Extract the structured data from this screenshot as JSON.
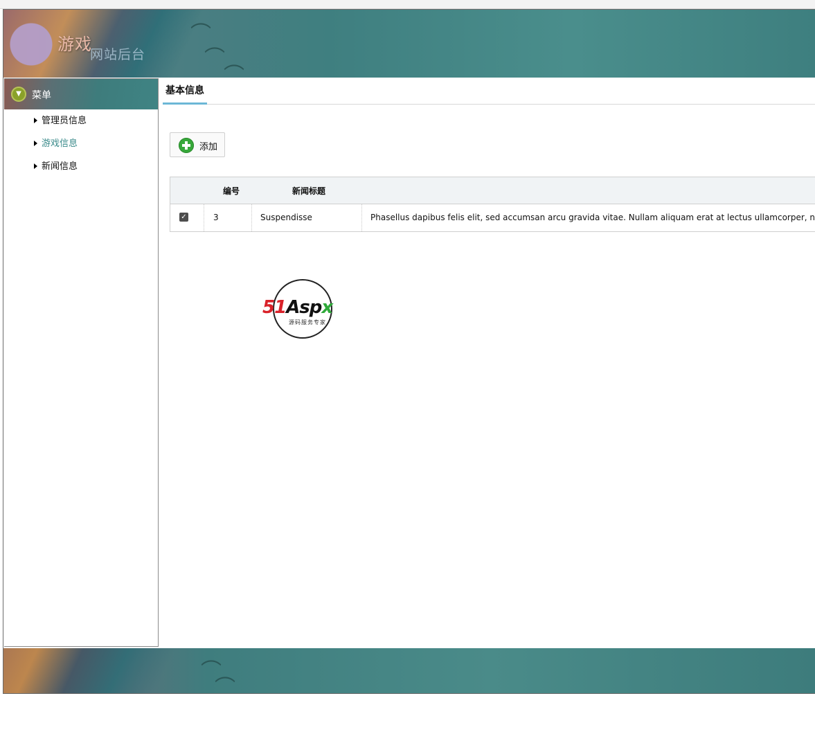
{
  "app": {
    "banner_title": "游戏",
    "banner_subtitle": "网站后台"
  },
  "sidebar": {
    "header_label": "菜单",
    "items": [
      {
        "label": "管理员信息",
        "active": false
      },
      {
        "label": "游戏信息",
        "active": true
      },
      {
        "label": "新闻信息",
        "active": false
      }
    ]
  },
  "main": {
    "tab_label": "基本信息",
    "add_button_label": "添加",
    "table": {
      "headers": [
        "编号",
        "新闻标题"
      ],
      "rows": [
        {
          "checked": true,
          "id": "3",
          "title": "Suspendisse",
          "content": "Phasellus dapibus felis elit, sed accumsan arcu gravida vitae. Nullam aliquam erat at lectus ullamcorper, n"
        }
      ]
    },
    "watermark": {
      "brand_51": "51",
      "brand_aspx": "Asp",
      "brand_x": "x",
      "tagline": "源码服务专家"
    }
  },
  "colors": {
    "accent": "#6cb7d6",
    "active_link": "#3a8a8a",
    "add_icon": "#37a83a",
    "banner": "#4a8e8c"
  },
  "icons": {
    "menu_header": "chevron-down-circle-icon",
    "sidebar_bullet": "caret-right-icon",
    "add": "plus-circle-icon",
    "checkbox": "checkbox-checked-icon"
  }
}
